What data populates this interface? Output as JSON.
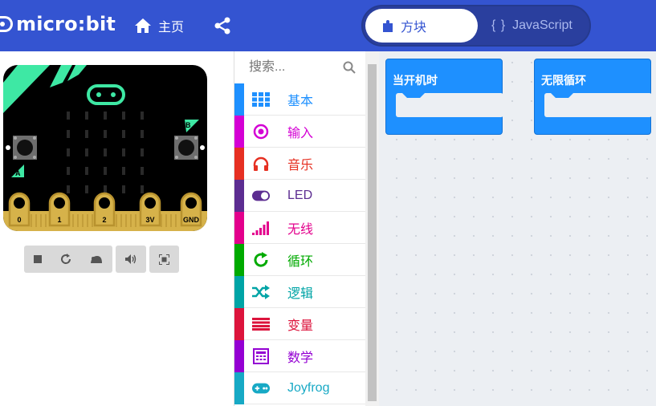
{
  "header": {
    "logo_text": "micro:bit",
    "home_label": "主页",
    "share_icon": "share-icon",
    "mode_tabs": [
      {
        "label": "方块",
        "icon": "puzzle-icon",
        "selected": true
      },
      {
        "label": "JavaScript",
        "icon": "braces-icon",
        "selected": false
      }
    ],
    "braces": "{ }"
  },
  "simulator": {
    "pins": [
      "0",
      "1",
      "2",
      "3V",
      "GND"
    ],
    "button_a": "A",
    "button_b": "B",
    "controls": [
      "stop-icon",
      "restart-icon",
      "slowmo-icon",
      "mute-icon",
      "fullscreen-icon"
    ]
  },
  "toolbox": {
    "search_placeholder": "搜索...",
    "categories": [
      {
        "label": "基本",
        "color": "#1e90ff",
        "icon": "grid-icon"
      },
      {
        "label": "输入",
        "color": "#d400d4",
        "icon": "target-icon"
      },
      {
        "label": "音乐",
        "color": "#e63022",
        "icon": "headphones-icon"
      },
      {
        "label": "LED",
        "color": "#5c2d91",
        "icon": "toggle-icon"
      },
      {
        "label": "无线",
        "color": "#e3008c",
        "icon": "signal-icon"
      },
      {
        "label": "循环",
        "color": "#00aa00",
        "icon": "refresh-icon"
      },
      {
        "label": "逻辑",
        "color": "#00a4a6",
        "icon": "shuffle-icon"
      },
      {
        "label": "变量",
        "color": "#dc143c",
        "icon": "lines-icon"
      },
      {
        "label": "数学",
        "color": "#9400d3",
        "icon": "calculator-icon"
      },
      {
        "label": "Joyfrog",
        "color": "#17a9c5",
        "icon": "gamepad-icon"
      }
    ]
  },
  "workspace": {
    "blocks": [
      {
        "label": "当开机时"
      },
      {
        "label": "无限循环"
      }
    ]
  },
  "colors": {
    "header": "#3454d1",
    "block": "#1e90ff",
    "workspace": "#eceff3"
  }
}
